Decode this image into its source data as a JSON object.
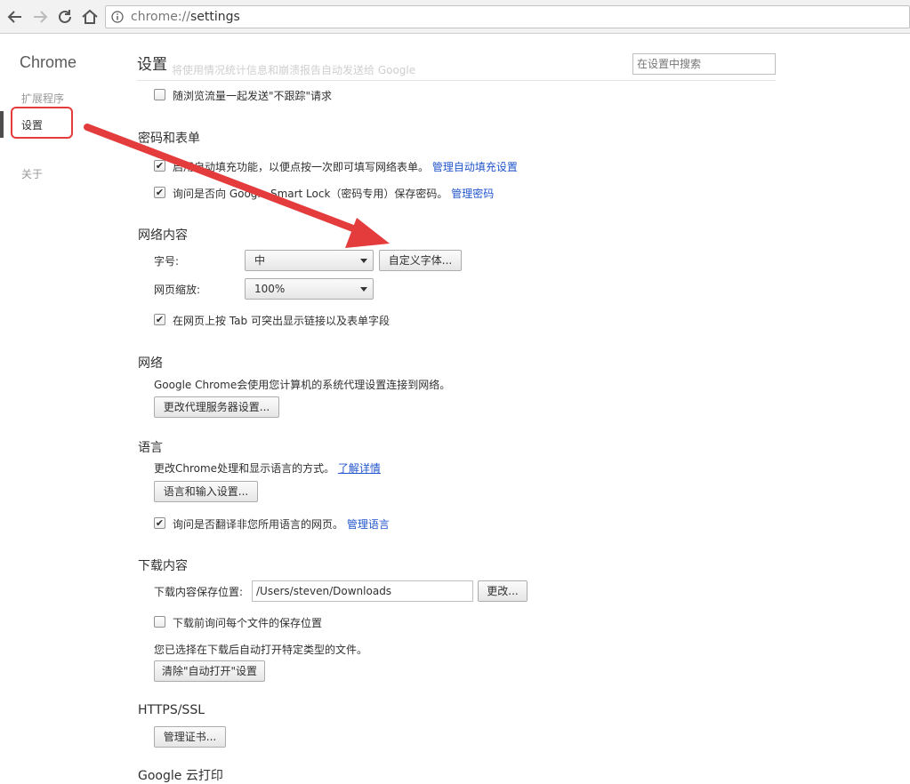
{
  "toolbar": {
    "url_scheme": "chrome://",
    "url_path": "settings"
  },
  "sidebar": {
    "brand": "Chrome",
    "items": [
      {
        "label": "扩展程序"
      },
      {
        "label": "设置"
      },
      {
        "label": "关于"
      }
    ]
  },
  "header": {
    "title": "设置",
    "ghost_text": "将使用情况统计信息和崩溃报告自动发送给 Google",
    "search_placeholder": "在设置中搜索"
  },
  "privacy": {
    "dnt_label": "随浏览流量一起发送\"不跟踪\"请求",
    "dnt_checked": false
  },
  "passwords": {
    "title": "密码和表单",
    "autofill_label": "启用自动填充功能，以便点按一次即可填写网络表单。",
    "autofill_link": "管理自动填充设置",
    "autofill_checked": true,
    "smartlock_label": "询问是否向 Google Smart Lock（密码专用）保存密码。",
    "smartlock_link": "管理密码",
    "smartlock_checked": true
  },
  "web_content": {
    "title": "网络内容",
    "font_size_label": "字号:",
    "font_size_value": "中",
    "custom_fonts_button": "自定义字体...",
    "zoom_label": "网页缩放:",
    "zoom_value": "100%",
    "tab_label": "在网页上按 Tab 可突出显示链接以及表单字段",
    "tab_checked": true
  },
  "network": {
    "title": "网络",
    "description": "Google Chrome会使用您计算机的系统代理设置连接到网络。",
    "proxy_button": "更改代理服务器设置..."
  },
  "languages": {
    "title": "语言",
    "description": "更改Chrome处理和显示语言的方式。",
    "learn_more": "了解详情",
    "input_button": "语言和输入设置...",
    "translate_label": "询问是否翻译非您所用语言的网页。",
    "translate_link": "管理语言",
    "translate_checked": true
  },
  "downloads": {
    "title": "下载内容",
    "location_label": "下载内容保存位置:",
    "location_value": "/Users/steven/Downloads",
    "change_button": "更改...",
    "ask_label": "下载前询问每个文件的保存位置",
    "ask_checked": false,
    "auto_open_text": "您已选择在下载后自动打开特定类型的文件。",
    "clear_button": "清除\"自动打开\"设置"
  },
  "https": {
    "title": "HTTPS/SSL",
    "certs_button": "管理证书..."
  },
  "cloud_print": {
    "title": "Google 云打印"
  },
  "colors": {
    "link": "#2255cc",
    "annotation_red": "#e43c3c"
  }
}
